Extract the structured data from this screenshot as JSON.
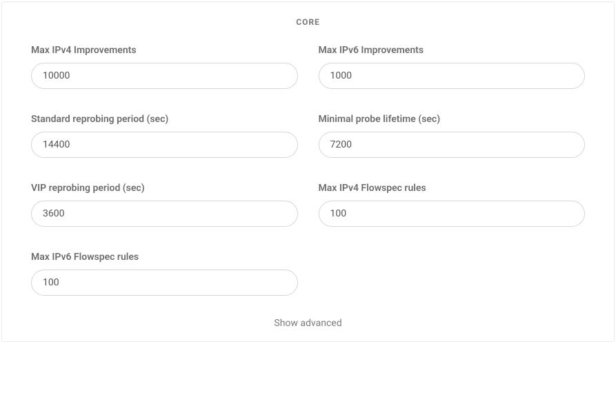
{
  "section": {
    "title": "CORE"
  },
  "fields": {
    "maxIpv4Improvements": {
      "label": "Max IPv4 Improvements",
      "value": "10000"
    },
    "maxIpv6Improvements": {
      "label": "Max IPv6 Improvements",
      "value": "1000"
    },
    "stdReprobingPeriod": {
      "label": "Standard reprobing period (sec)",
      "value": "14400"
    },
    "minProbeLifetime": {
      "label": "Minimal probe lifetime (sec)",
      "value": "7200"
    },
    "vipReprobingPeriod": {
      "label": "VIP reprobing period (sec)",
      "value": "3600"
    },
    "maxIpv4FlowspecRules": {
      "label": "Max IPv4 Flowspec rules",
      "value": "100"
    },
    "maxIpv6FlowspecRules": {
      "label": "Max IPv6 Flowspec rules",
      "value": "100"
    }
  },
  "footer": {
    "showAdvanced": "Show advanced"
  }
}
